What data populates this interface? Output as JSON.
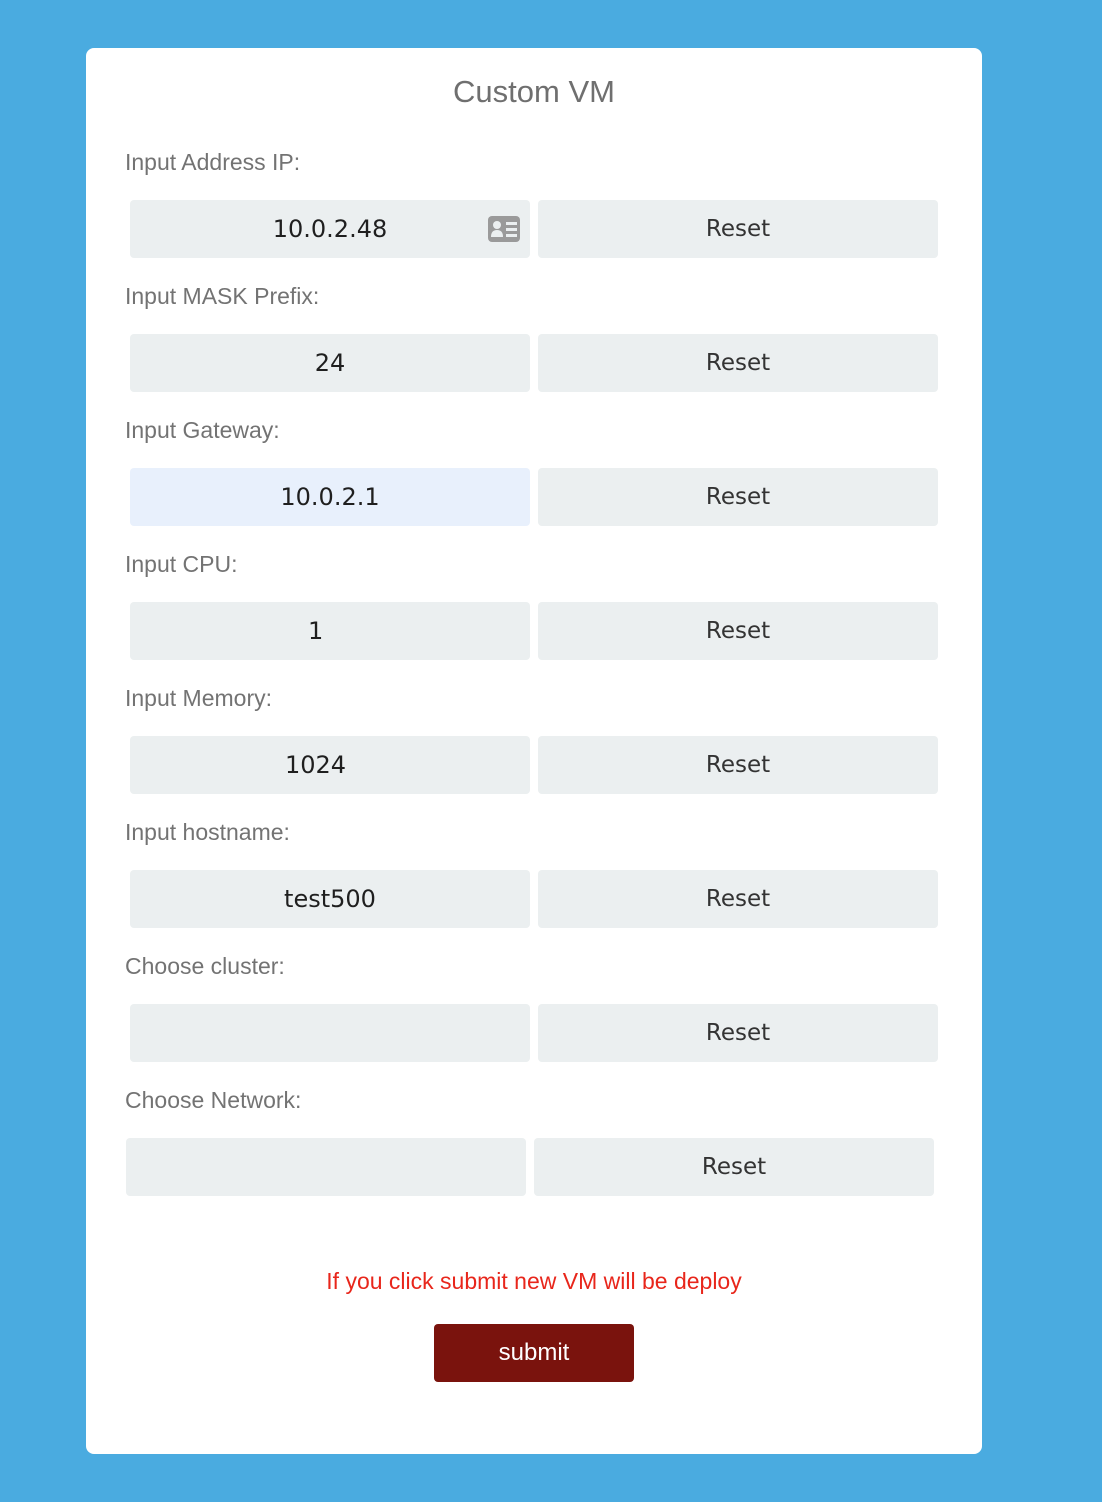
{
  "form": {
    "title": "Custom VM",
    "reset_label": "Reset",
    "rows": [
      {
        "label": "Input Address IP:",
        "value": "10.0.2.48"
      },
      {
        "label": "Input MASK Prefix:",
        "value": "24"
      },
      {
        "label": "Input Gateway:",
        "value": "10.0.2.1"
      },
      {
        "label": "Input CPU:",
        "value": "1"
      },
      {
        "label": "Input Memory:",
        "value": "1024"
      },
      {
        "label": "Input hostname:",
        "value": "test500"
      },
      {
        "label": "Choose cluster:",
        "value": ""
      },
      {
        "label": "Choose Network:",
        "value": ""
      }
    ],
    "warning": "If you click submit new VM will be deploy",
    "submit_label": "submit"
  },
  "icons": {
    "ip_field": "contact-card-icon"
  },
  "colors": {
    "background": "#4aabe0",
    "warning": "#e8261b",
    "submit": "#7a130d",
    "autofill": "#e8f0fc"
  }
}
